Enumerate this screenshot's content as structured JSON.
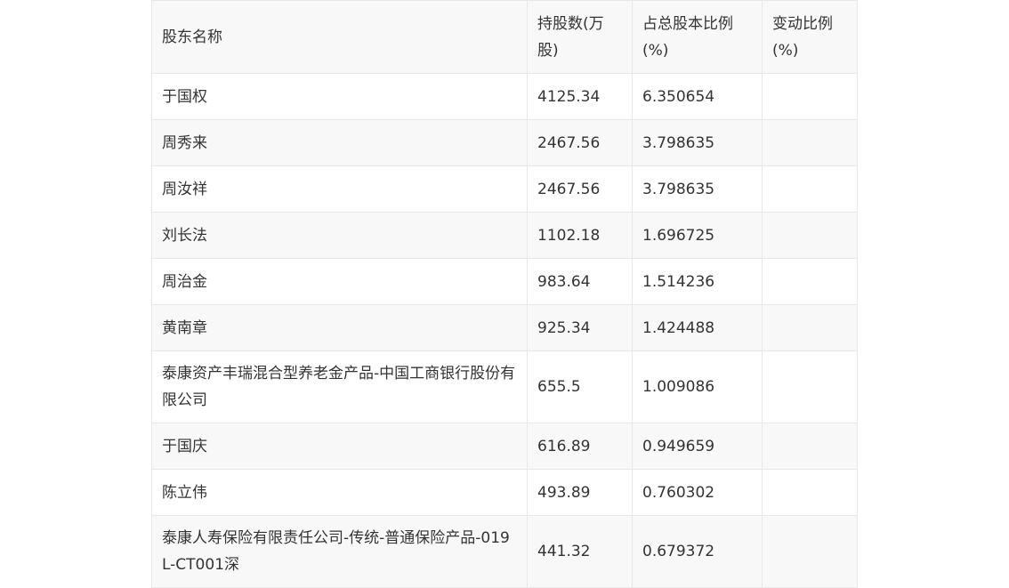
{
  "table": {
    "headers": [
      "股东名称",
      "持股数(万股)",
      "占总股本比例(%)",
      "变动比例(%)"
    ],
    "rows": [
      {
        "name": "于国权",
        "shares": "4125.34",
        "ratio": "6.350654",
        "change": ""
      },
      {
        "name": "周秀来",
        "shares": "2467.56",
        "ratio": "3.798635",
        "change": ""
      },
      {
        "name": "周汝祥",
        "shares": "2467.56",
        "ratio": "3.798635",
        "change": ""
      },
      {
        "name": "刘长法",
        "shares": "1102.18",
        "ratio": "1.696725",
        "change": ""
      },
      {
        "name": "周治金",
        "shares": "983.64",
        "ratio": "1.514236",
        "change": ""
      },
      {
        "name": "黄南章",
        "shares": "925.34",
        "ratio": "1.424488",
        "change": ""
      },
      {
        "name": "泰康资产丰瑞混合型养老金产品-中国工商银行股份有限公司",
        "shares": "655.5",
        "ratio": "1.009086",
        "change": ""
      },
      {
        "name": "于国庆",
        "shares": "616.89",
        "ratio": "0.949659",
        "change": ""
      },
      {
        "name": "陈立伟",
        "shares": "493.89",
        "ratio": "0.760302",
        "change": ""
      },
      {
        "name": "泰康人寿保险有限责任公司-传统-普通保险产品-019L-CT001深",
        "shares": "441.32",
        "ratio": "0.679372",
        "change": ""
      }
    ]
  }
}
